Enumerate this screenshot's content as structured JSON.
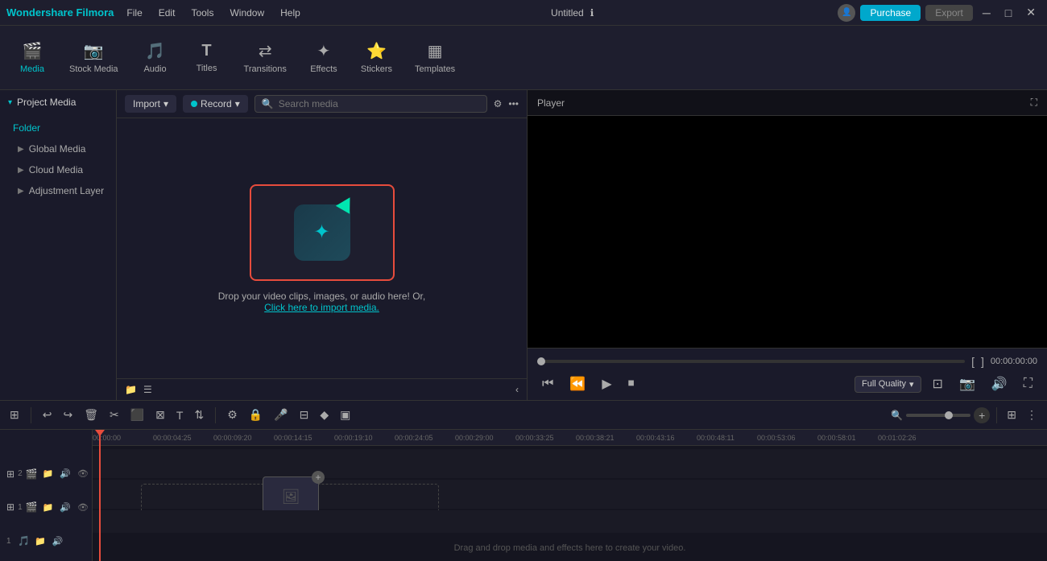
{
  "app": {
    "name": "Wondershare Filmora",
    "title": "Untitled"
  },
  "menu": {
    "items": [
      "File",
      "Edit",
      "Tools",
      "Window",
      "Help"
    ]
  },
  "toolbar": {
    "items": [
      {
        "id": "media",
        "label": "Media",
        "icon": "🎬",
        "active": true
      },
      {
        "id": "stock-media",
        "label": "Stock Media",
        "icon": "📷"
      },
      {
        "id": "audio",
        "label": "Audio",
        "icon": "🎵"
      },
      {
        "id": "titles",
        "label": "Titles",
        "icon": "T"
      },
      {
        "id": "transitions",
        "label": "Transitions",
        "icon": "⟷"
      },
      {
        "id": "effects",
        "label": "Effects",
        "icon": "✦"
      },
      {
        "id": "stickers",
        "label": "Stickers",
        "icon": "⭐"
      },
      {
        "id": "templates",
        "label": "Templates",
        "icon": "▦"
      }
    ]
  },
  "purchase_btn": "Purchase",
  "export_btn": "Export",
  "left_panel": {
    "header": "Project Media",
    "items": [
      {
        "label": "Folder",
        "type": "folder"
      },
      {
        "label": "Global Media",
        "type": "item"
      },
      {
        "label": "Cloud Media",
        "type": "item"
      },
      {
        "label": "Adjustment Layer",
        "type": "item"
      }
    ]
  },
  "media_panel": {
    "import_label": "Import",
    "record_label": "Record",
    "search_placeholder": "Search media",
    "drop_text": "Drop your video clips, images, or audio here! Or,",
    "drop_link": "Click here to import media."
  },
  "player": {
    "title": "Player",
    "time": "00:00:00:00",
    "quality_label": "Full Quality"
  },
  "timeline": {
    "tracks": [
      {
        "id": 2,
        "type": "video"
      },
      {
        "id": 1,
        "type": "video"
      },
      {
        "id": 1,
        "type": "audio"
      }
    ],
    "drop_text": "Drag and drop media and effects here to create your video.",
    "ruler_marks": [
      "00:00:00",
      "00:00:04:25",
      "00:00:09:20",
      "00:00:14:15",
      "00:00:19:10",
      "00:00:24:05",
      "00:00:29:00",
      "00:00:33:25",
      "00:00:38:21",
      "00:00:43:16",
      "00:00:48:11",
      "00:00:53:06",
      "00:00:58:01",
      "00:01:02:26"
    ]
  }
}
